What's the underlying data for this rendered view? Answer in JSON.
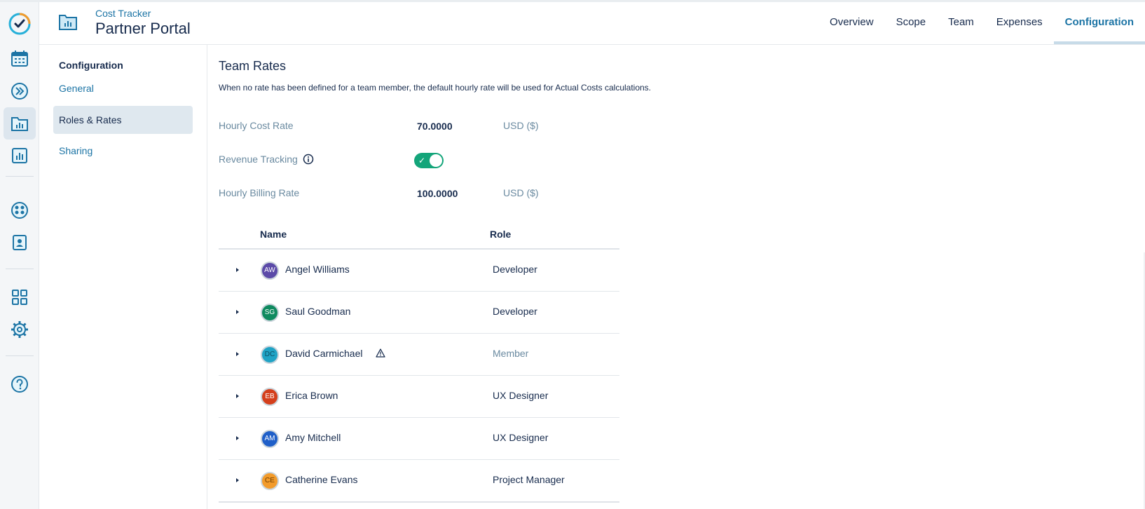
{
  "header": {
    "app_subtitle": "Cost Tracker",
    "app_title": "Partner Portal",
    "tabs": [
      {
        "label": "Overview",
        "active": false
      },
      {
        "label": "Scope",
        "active": false
      },
      {
        "label": "Team",
        "active": false
      },
      {
        "label": "Expenses",
        "active": false
      },
      {
        "label": "Configuration",
        "active": true
      }
    ]
  },
  "rail": {
    "items": [
      "logo-check-icon",
      "calendar-icon",
      "double-chevron-icon",
      "folder-chart-icon",
      "bar-chart-icon",
      "team-icon",
      "contact-icon",
      "apps-grid-icon",
      "settings-gear-icon",
      "help-icon"
    ],
    "active": "folder-chart-icon"
  },
  "config_sidebar": {
    "heading": "Configuration",
    "items": [
      {
        "label": "General",
        "active": false
      },
      {
        "label": "Roles & Rates",
        "active": true
      },
      {
        "label": "Sharing",
        "active": false
      }
    ]
  },
  "team_rates": {
    "title": "Team Rates",
    "description": "When no rate has been defined for a team member, the default hourly rate will be used for Actual Costs calculations.",
    "hourly_cost_rate": {
      "label": "Hourly Cost Rate",
      "value": "70.0000",
      "currency": "USD ($)"
    },
    "revenue_tracking": {
      "label": "Revenue Tracking",
      "enabled": true,
      "check": "✓"
    },
    "hourly_billing_rate": {
      "label": "Hourly Billing Rate",
      "value": "100.0000",
      "currency": "USD ($)"
    }
  },
  "table": {
    "columns": [
      "Name",
      "Role"
    ],
    "rows": [
      {
        "initials": "AW",
        "name": "Angel Williams",
        "role": "Developer",
        "avatar_color": "#5b4aa8",
        "warning": false,
        "role_muted": false
      },
      {
        "initials": "SG",
        "name": "Saul Goodman",
        "role": "Developer",
        "avatar_color": "#0f8a5f",
        "warning": false,
        "role_muted": false
      },
      {
        "initials": "DC",
        "name": "David Carmichael",
        "role": "Member",
        "avatar_color": "#1fa3c5",
        "warning": true,
        "role_muted": true
      },
      {
        "initials": "EB",
        "name": "Erica Brown",
        "role": "UX Designer",
        "avatar_color": "#d43f1c",
        "warning": false,
        "role_muted": false
      },
      {
        "initials": "AM",
        "name": "Amy Mitchell",
        "role": "UX Designer",
        "avatar_color": "#1f5fc8",
        "warning": false,
        "role_muted": false
      },
      {
        "initials": "CE",
        "name": "Catherine Evans",
        "role": "Project Manager",
        "avatar_color": "#f29b2b",
        "warning": false,
        "role_muted": false
      }
    ]
  },
  "colors": {
    "accent": "#1c74a5",
    "toggle_on": "#14a57a",
    "muted_label": "#6a8aa0"
  }
}
